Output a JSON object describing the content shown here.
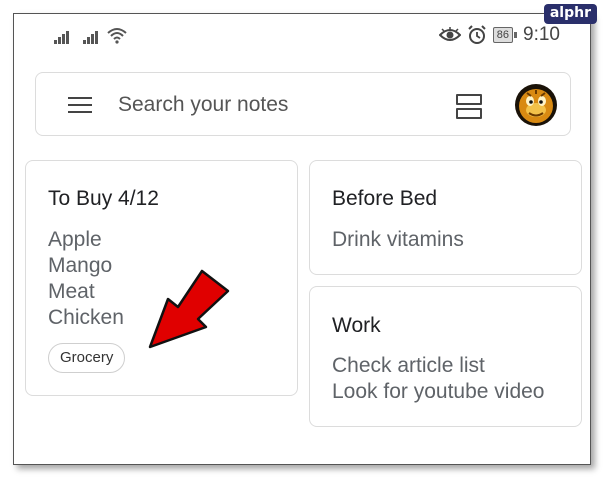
{
  "watermark": "alphr",
  "status_bar": {
    "signal1_label": "..ıl",
    "signal2_label": "..ıl",
    "battery_level": "86",
    "time": "9:10",
    "icons": [
      "signal-icon",
      "signal-icon",
      "wifi-icon",
      "eye-icon",
      "alarm-icon",
      "battery-icon"
    ]
  },
  "search": {
    "placeholder": "Search your notes"
  },
  "notes": [
    {
      "title": "To Buy 4/12",
      "lines": [
        "Apple",
        "Mango",
        "Meat",
        "Chicken"
      ],
      "label": "Grocery"
    },
    {
      "title": "Before Bed",
      "lines": [
        "Drink vitamins"
      ]
    },
    {
      "title": "Work",
      "lines": [
        "Check article list",
        "Look for youtube video"
      ]
    }
  ],
  "colors": {
    "arrow": "#e00000",
    "watermark_bg": "#2a2f6b",
    "card_border": "#dcdcdc"
  }
}
